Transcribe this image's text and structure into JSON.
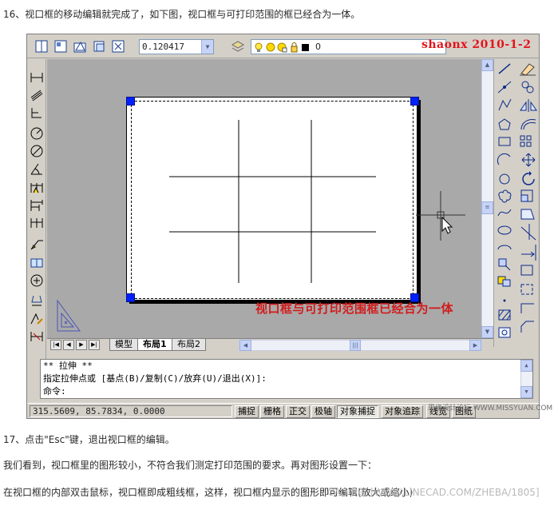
{
  "article": {
    "step16": "16、视口框的移动编辑就完成了，如下图，视口框与可打印范围的框已经合为一体。",
    "step17": "17、点击\"Esc\"键，退出视口框的编辑。",
    "line1": "我们看到，视口框里的图形较小，不符合我们测定打印范围的要求。再对图形设置一下：",
    "line2": "在视口框的内部双击鼠标，视口框即成粗线框，这样，视口框内显示的图形即可编辑(放大或缩小)",
    "watermark_bottom": "CAD中国 [WWW.LINECAD.COM/ZHEBA/1805]"
  },
  "cad": {
    "signature": "shaonx  2010-1-2",
    "toolbar": {
      "scale_value": "0.120417",
      "layer_name": "0"
    },
    "annotation": "视口框与可打印范围框已经合为一体",
    "tabs": [
      {
        "label": "模型"
      },
      {
        "label": "布局1",
        "active": true
      },
      {
        "label": "布局2"
      }
    ],
    "command": {
      "line1": "** 拉伸 **",
      "line2": "指定拉伸点或 [基点(B)/复制(C)/放弃(U)/退出(X)]:",
      "prompt": "命令:"
    },
    "status": {
      "coords": "315.5609, 85.7834, 0.0000",
      "buttons": [
        {
          "label": "捕捉",
          "on": false
        },
        {
          "label": "栅格",
          "on": false
        },
        {
          "label": "正交",
          "on": false
        },
        {
          "label": "极轴",
          "on": false
        },
        {
          "label": "对象捕捉",
          "on": true
        },
        {
          "label": "对象追踪",
          "on": false
        },
        {
          "label": "线宽",
          "on": false
        },
        {
          "label": "图纸",
          "on": false
        }
      ],
      "site_watermark": "思缘设计论坛 WWW.MISSYUAN.COM"
    },
    "colors": {
      "grip": "#0020ff",
      "annotation": "#d21c1c",
      "signature": "#e3141b",
      "model_space": "#a9a9a9"
    },
    "icons": {
      "left_toolbar": [
        "linear-dim-icon",
        "aligned-dim-icon",
        "ordinate-dim-icon",
        "radius-dim-icon",
        "diameter-dim-icon",
        "angular-dim-icon",
        "quick-dim-icon",
        "baseline-dim-icon",
        "continue-dim-icon",
        "leader-icon",
        "tolerance-icon",
        "center-mark-icon",
        "dim-edit-icon",
        "dim-text-edit-icon",
        "dim-update-icon"
      ],
      "right_draw": [
        "line-icon",
        "construction-line-icon",
        "polyline-icon",
        "polygon-icon",
        "rectangle-icon",
        "arc-icon",
        "circle-icon",
        "revcloud-icon",
        "spline-icon",
        "ellipse-icon",
        "ellipse-arc-icon",
        "insert-block-icon",
        "make-block-icon",
        "point-icon",
        "hatch-icon",
        "region-icon",
        "table-icon",
        "mtext-icon"
      ],
      "right_modify": [
        "erase-icon",
        "copy-icon",
        "mirror-icon",
        "offset-icon",
        "array-icon",
        "move-icon",
        "rotate-icon",
        "scale-icon",
        "stretch-icon",
        "trim-icon",
        "extend-icon",
        "break-at-point-icon",
        "break-icon",
        "join-icon",
        "chamfer-icon",
        "fillet-icon",
        "explode-icon"
      ]
    }
  }
}
